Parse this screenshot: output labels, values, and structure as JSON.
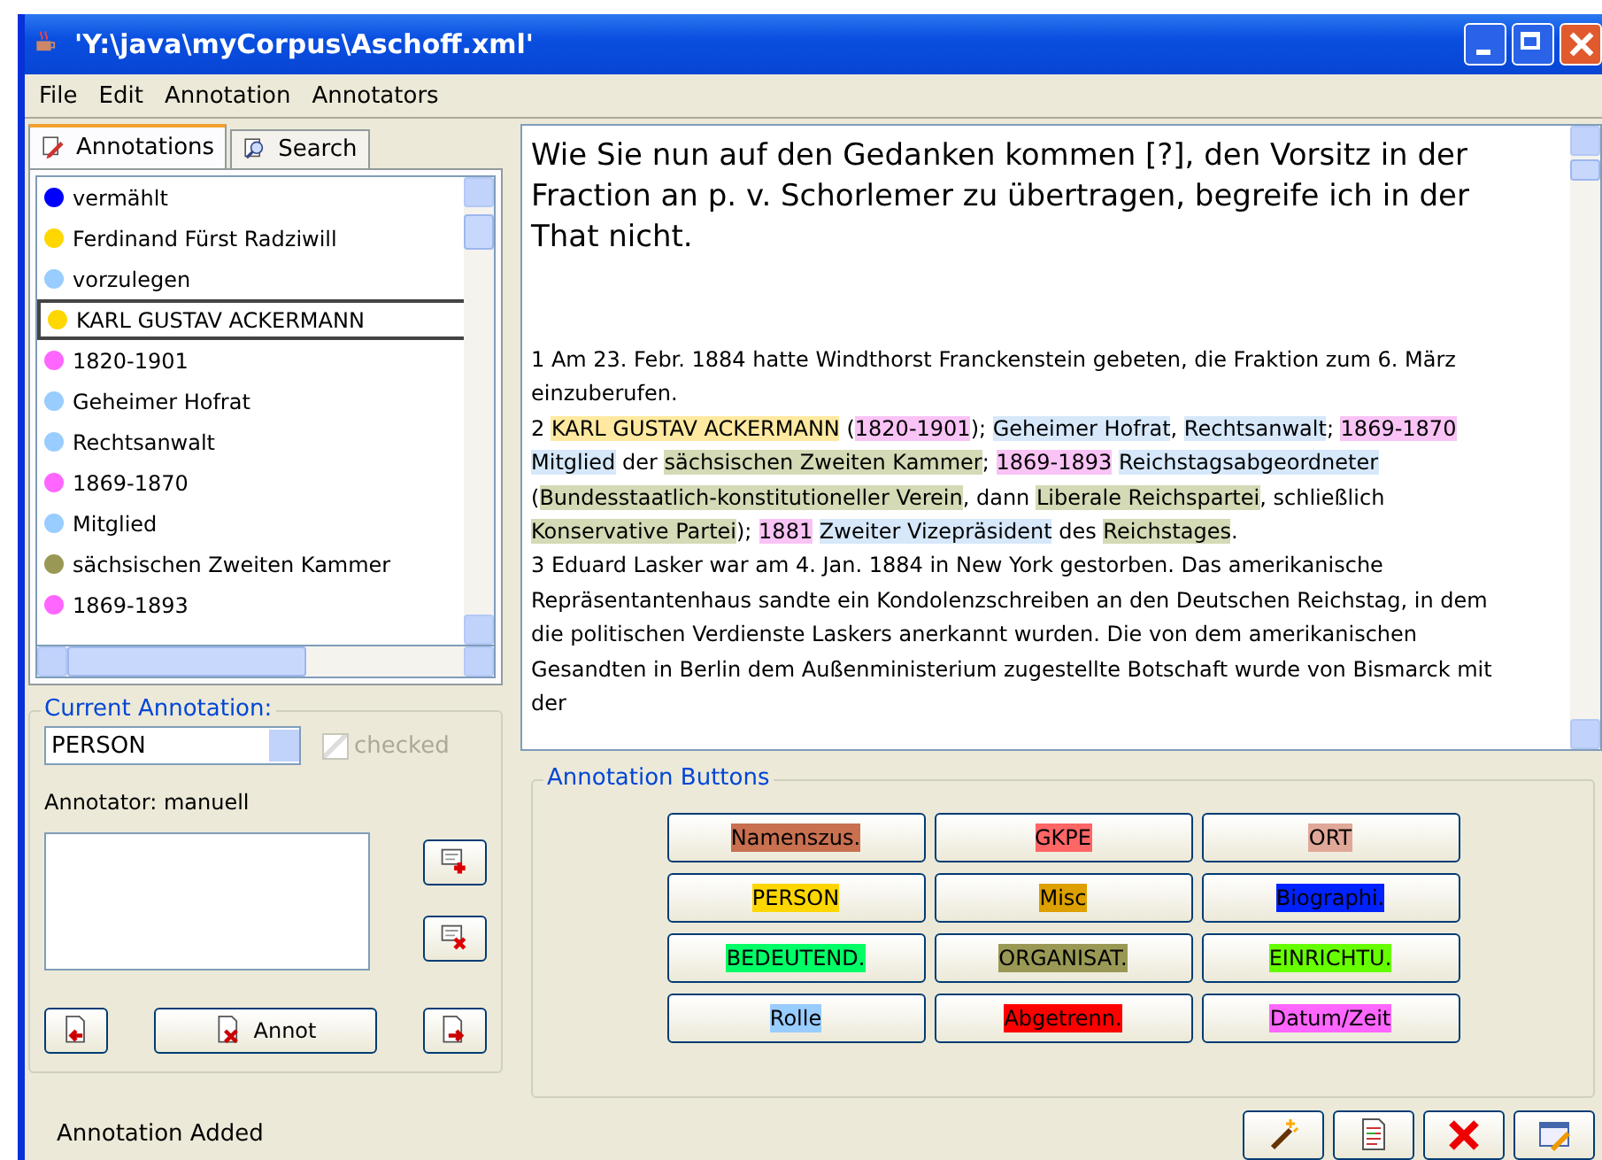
{
  "window": {
    "title": "'Y:\\java\\myCorpus\\Aschoff.xml'"
  },
  "menu": [
    "File",
    "Edit",
    "Annotation",
    "Annotators"
  ],
  "tabs": [
    {
      "label": "Annotations",
      "selected": true,
      "kind": "annotations"
    },
    {
      "label": "Search",
      "selected": false,
      "kind": "search"
    }
  ],
  "annotations": [
    {
      "label": "vermählt",
      "color": "#0000ff",
      "selected": false
    },
    {
      "label": "Ferdinand Fürst Radziwill",
      "color": "#ffd700",
      "selected": false
    },
    {
      "label": "vorzulegen",
      "color": "#99ccff",
      "selected": false
    },
    {
      "label": "KARL GUSTAV ACKERMANN",
      "color": "#ffd700",
      "selected": true
    },
    {
      "label": "1820-1901",
      "color": "#ff66ff",
      "selected": false
    },
    {
      "label": "Geheimer Hofrat",
      "color": "#99ccff",
      "selected": false
    },
    {
      "label": "Rechtsanwalt",
      "color": "#99ccff",
      "selected": false
    },
    {
      "label": "1869-1870",
      "color": "#ff66ff",
      "selected": false
    },
    {
      "label": "Mitglied",
      "color": "#99ccff",
      "selected": false
    },
    {
      "label": "sächsischen Zweiten Kammer",
      "color": "#999955",
      "selected": false
    },
    {
      "label": "1869-1893",
      "color": "#ff66ff",
      "selected": false
    }
  ],
  "current_annotation": {
    "title": "Current Annotation:",
    "type": "PERSON",
    "checked_label": "checked",
    "checked": true,
    "checked_disabled": true,
    "annotator": "Annotator: manuell",
    "annot_button": "Annot"
  },
  "document": {
    "heading": "Wie Sie nun auf den Gedanken kommen [?], den Vorsitz in der Fraction an p. v. Schorlemer zu übertragen, begreife ich in der That nicht.",
    "notes": [
      [
        {
          "text": "1 Am 23. Febr. 1884 hatte Windthorst Franckenstein gebeten, die Fraktion zum 6. März einzuberufen."
        }
      ],
      [
        {
          "text": "2 "
        },
        {
          "text": "KARL GUSTAV ACKERMANN",
          "color": "#ffe9a0"
        },
        {
          "text": " ("
        },
        {
          "text": "1820-1901",
          "color": "#f9c3f5"
        },
        {
          "text": "); "
        },
        {
          "text": "Geheimer Hofrat",
          "color": "#d6e8fa"
        },
        {
          "text": ", "
        },
        {
          "text": "Rechtsanwalt",
          "color": "#d6e8fa"
        },
        {
          "text": "; "
        },
        {
          "text": "1869-1870",
          "color": "#f9c3f5"
        },
        {
          "text": "Mitglied",
          "color": "#d6e8fa",
          "space_before": true
        },
        {
          "text": " der "
        },
        {
          "text": "sächsischen Zweiten Kammer",
          "color": "#d3dab5"
        },
        {
          "text": "; "
        },
        {
          "text": "1869-1893",
          "color": "#f9c3f5"
        },
        {
          "text": "Reichstagsabgeordneter",
          "color": "#d6e8fa",
          "space_before": true
        },
        {
          "text": " ("
        },
        {
          "text": "Bundesstaatlich-konstitutioneller Verein",
          "color": "#d3dab5"
        },
        {
          "text": ", dann "
        },
        {
          "text": "Liberale Reichspartei",
          "color": "#d3dab5"
        },
        {
          "text": ", schließlich "
        },
        {
          "text": "Konservative Partei",
          "color": "#d3dab5"
        },
        {
          "text": "); "
        },
        {
          "text": "1881",
          "color": "#f9c3f5"
        },
        {
          "text": "Zweiter Vizepräsident",
          "color": "#d6e8fa",
          "space_before": true
        },
        {
          "text": " des "
        },
        {
          "text": "Reichstages",
          "color": "#d3dab5"
        },
        {
          "text": "."
        }
      ],
      [
        {
          "text": "3 Eduard Lasker war am 4. Jan. 1884 in New York gestorben. Das amerikanische Repräsentantenhaus sandte ein Kondolenzschreiben an den Deutschen Reichstag, in dem die politischen Verdienste Laskers anerkannt wurden. Die von dem amerikanischen Gesandten in Berlin dem Außenministerium zugestellte Botschaft wurde von Bismarck mit der"
        }
      ]
    ]
  },
  "annotation_buttons": {
    "title": "Annotation Buttons",
    "buttons": [
      {
        "label": "Namenszus.",
        "color": "#c87050"
      },
      {
        "label": "GKPE",
        "color": "#ff6666"
      },
      {
        "label": "ORT",
        "color": "#e0a898"
      },
      {
        "label": "PERSON",
        "color": "#ffd700"
      },
      {
        "label": "Misc",
        "color": "#dda000"
      },
      {
        "label": "Biographi.",
        "color": "#0022ff"
      },
      {
        "label": "BEDEUTEND.",
        "color": "#00ff66"
      },
      {
        "label": "ORGANISAT.",
        "color": "#999955"
      },
      {
        "label": "EINRICHTU.",
        "color": "#66ff00"
      },
      {
        "label": "Rolle",
        "color": "#99ccff"
      },
      {
        "label": "Abgetrenn.",
        "color": "#ff0000"
      },
      {
        "label": "Datum/Zeit",
        "color": "#ff66ff"
      }
    ]
  },
  "status_bar": "Annotation Added"
}
